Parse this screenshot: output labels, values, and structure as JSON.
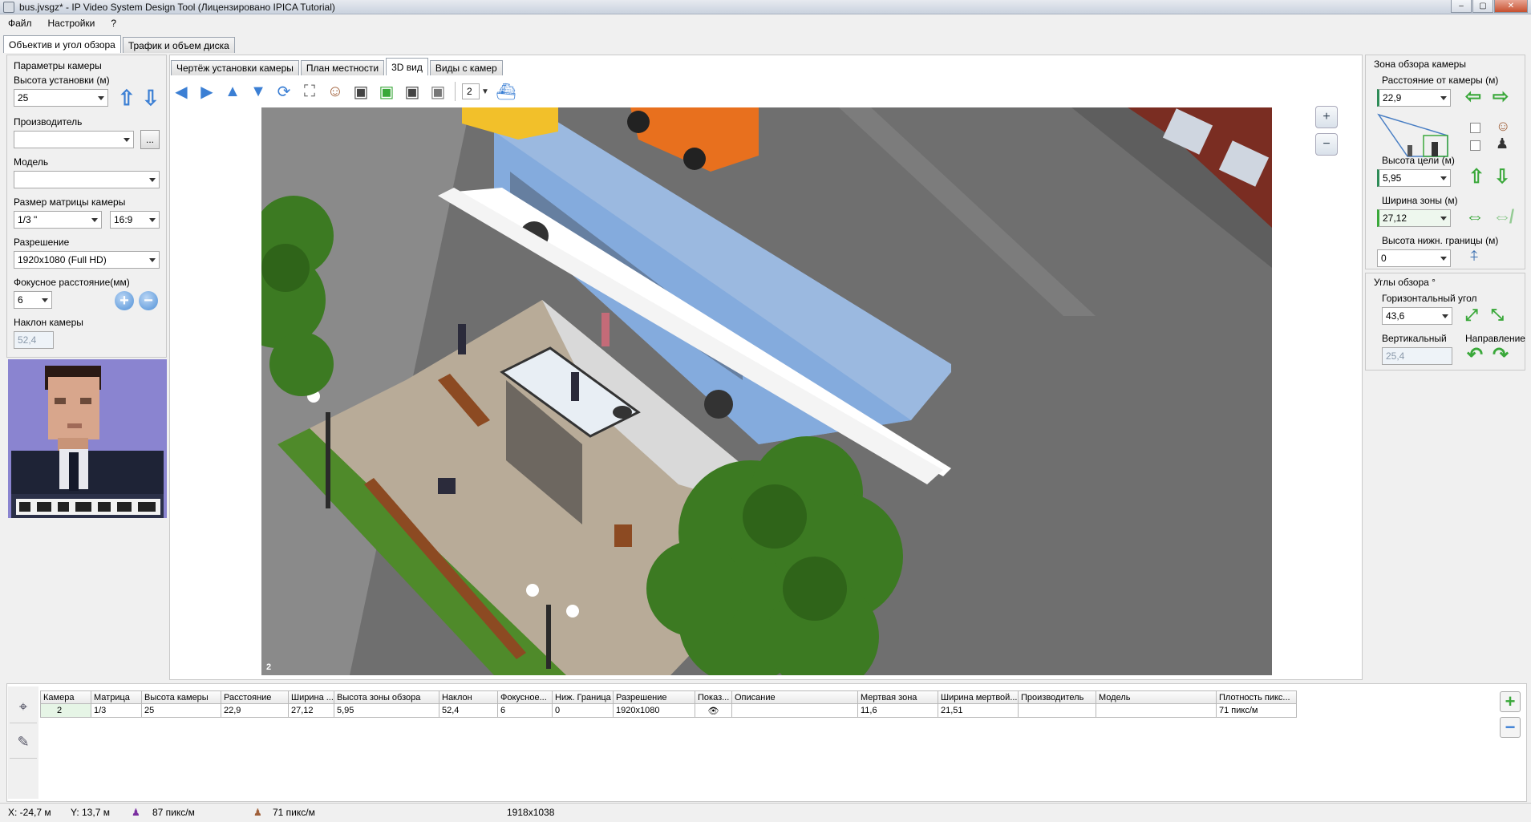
{
  "window": {
    "title": "bus.jvsgz* - IP Video System Design Tool (Лицензировано  IPICA Tutorial)",
    "buttons": [
      "–",
      "▢",
      "✕"
    ]
  },
  "menu": [
    "Файл",
    "Настройки",
    "?"
  ],
  "main_tabs": [
    "Объектив и угол обзора",
    "Трафик и объем диска"
  ],
  "left": {
    "group_title": "Параметры камеры",
    "height_label": "Высота установки (м)",
    "height_value": "25",
    "manufacturer_label": "Производитель",
    "manufacturer_value": "",
    "browse_label": "...",
    "model_label": "Модель",
    "model_value": "",
    "sensor_label": "Размер матрицы камеры",
    "sensor_value": "1/3 \"",
    "aspect_value": "16:9",
    "resolution_label": "Разрешение",
    "resolution_value": "1920x1080 (Full HD)",
    "focal_label": "Фокусное расстояние(мм)",
    "focal_value": "6",
    "tilt_label": "Наклон камеры",
    "tilt_value": "52,4",
    "plus": "+",
    "minus": "−",
    "up": "⇧",
    "down": "⇩"
  },
  "view_tabs": [
    "Чертёж установки камеры",
    "План местности",
    "3D вид",
    "Виды с камер"
  ],
  "toolbar": {
    "camera_select": "2",
    "icons": [
      "arrow-left-icon",
      "arrow-right-icon",
      "arrow-up-icon",
      "arrow-down-icon",
      "rotate-icon",
      "fit-icon",
      "person-icon",
      "person2-icon",
      "person3-icon",
      "person4-icon",
      "person5-icon"
    ]
  },
  "scene": {
    "camera_label": "2",
    "zoom_in": "+",
    "zoom_out": "−"
  },
  "right": {
    "group_title": "Зона обзора камеры",
    "distance_label": "Расстояние от камеры (м)",
    "distance_value": "22,9",
    "target_height_label": "Высота цели (м)",
    "target_height_value": "5,95",
    "zone_width_label": "Ширина зоны (м)",
    "zone_width_value": "27,12",
    "lower_height_label": "Высота нижн. границы (м)",
    "lower_height_value": "0",
    "angles_title": "Углы обзора °",
    "horizontal_label": "Горизонтальный угол",
    "horizontal_value": "43,6",
    "vertical_label": "Вертикальный",
    "vertical_value": "25,4",
    "direction_label": "Направление"
  },
  "table": {
    "columns": [
      "Камера",
      "Матрица",
      "Высота камеры",
      "Расстояние",
      "Ширина ...",
      "Высота зоны обзора",
      "Наклон",
      "Фокусное...",
      "Ниж. Граница",
      "Разрешение",
      "Показ...",
      "Описание",
      "Мертвая зона",
      "Ширина мертвой...",
      "Производитель",
      "Модель",
      "Плотность пикс..."
    ],
    "rows": [
      [
        "2",
        "1/3",
        "25",
        "22,9",
        "27,12",
        "5,95",
        "52,4",
        "6",
        "0",
        "1920x1080",
        "👁",
        "",
        "11,6",
        "21,51",
        "",
        "",
        "71 пикс/м"
      ]
    ],
    "add": "+",
    "remove": "−"
  },
  "status": {
    "x": "X: -24,7 м",
    "y": "Y: 13,7 м",
    "density1": "87 пикс/м",
    "density2": "71 пикс/м",
    "size": "1918x1038"
  },
  "colors": {
    "accent": "#3b7fd4",
    "green": "#3aa83a",
    "bus": "#7ea8dc",
    "grass": "#3c7a22"
  }
}
